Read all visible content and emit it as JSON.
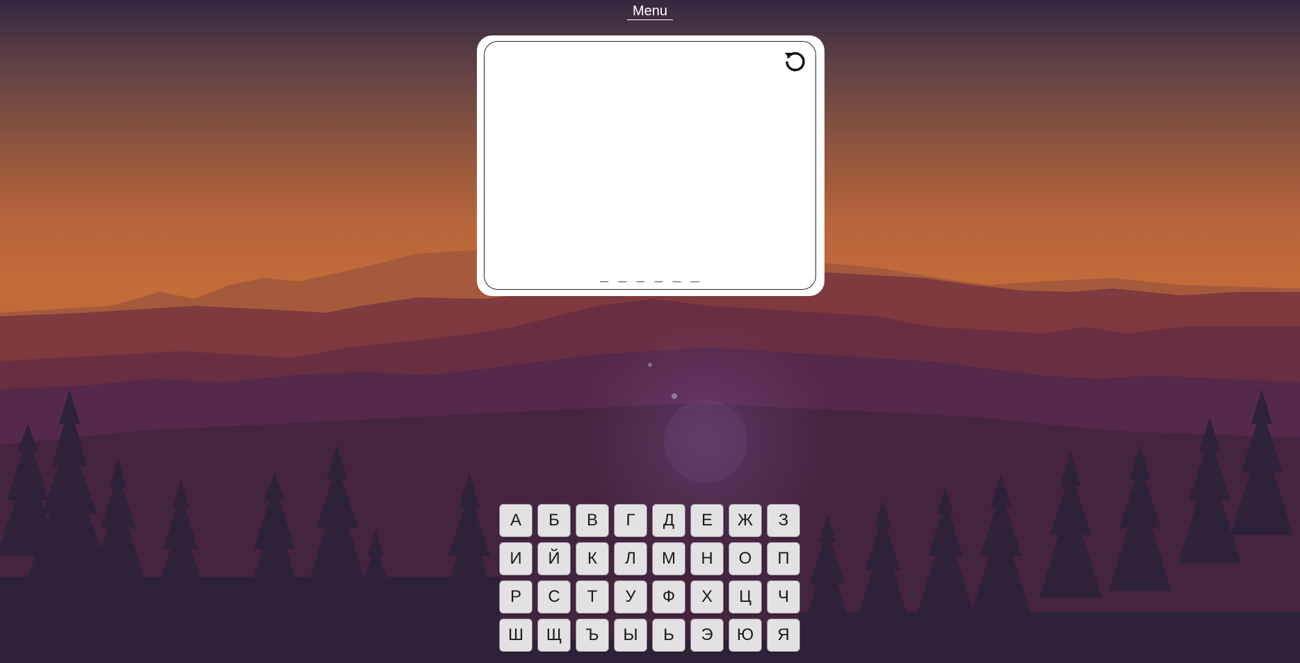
{
  "header": {
    "menu_label": "Menu"
  },
  "game": {
    "reset_icon": "reset-icon",
    "word_mask": "_ _ _ _ _ _"
  },
  "keyboard": {
    "keys": [
      "А",
      "Б",
      "В",
      "Г",
      "Д",
      "Е",
      "Ж",
      "З",
      "И",
      "Й",
      "К",
      "Л",
      "М",
      "Н",
      "О",
      "П",
      "Р",
      "С",
      "Т",
      "У",
      "Ф",
      "Х",
      "Ц",
      "Ч",
      "Ш",
      "Щ",
      "Ъ",
      "Ы",
      "Ь",
      "Э",
      "Ю",
      "Я"
    ]
  },
  "colors": {
    "sky_top": "#33283f",
    "sky_mid": "#c46c3a",
    "forest_dark": "#2e2238",
    "key_bg": "#e4e1e4"
  }
}
